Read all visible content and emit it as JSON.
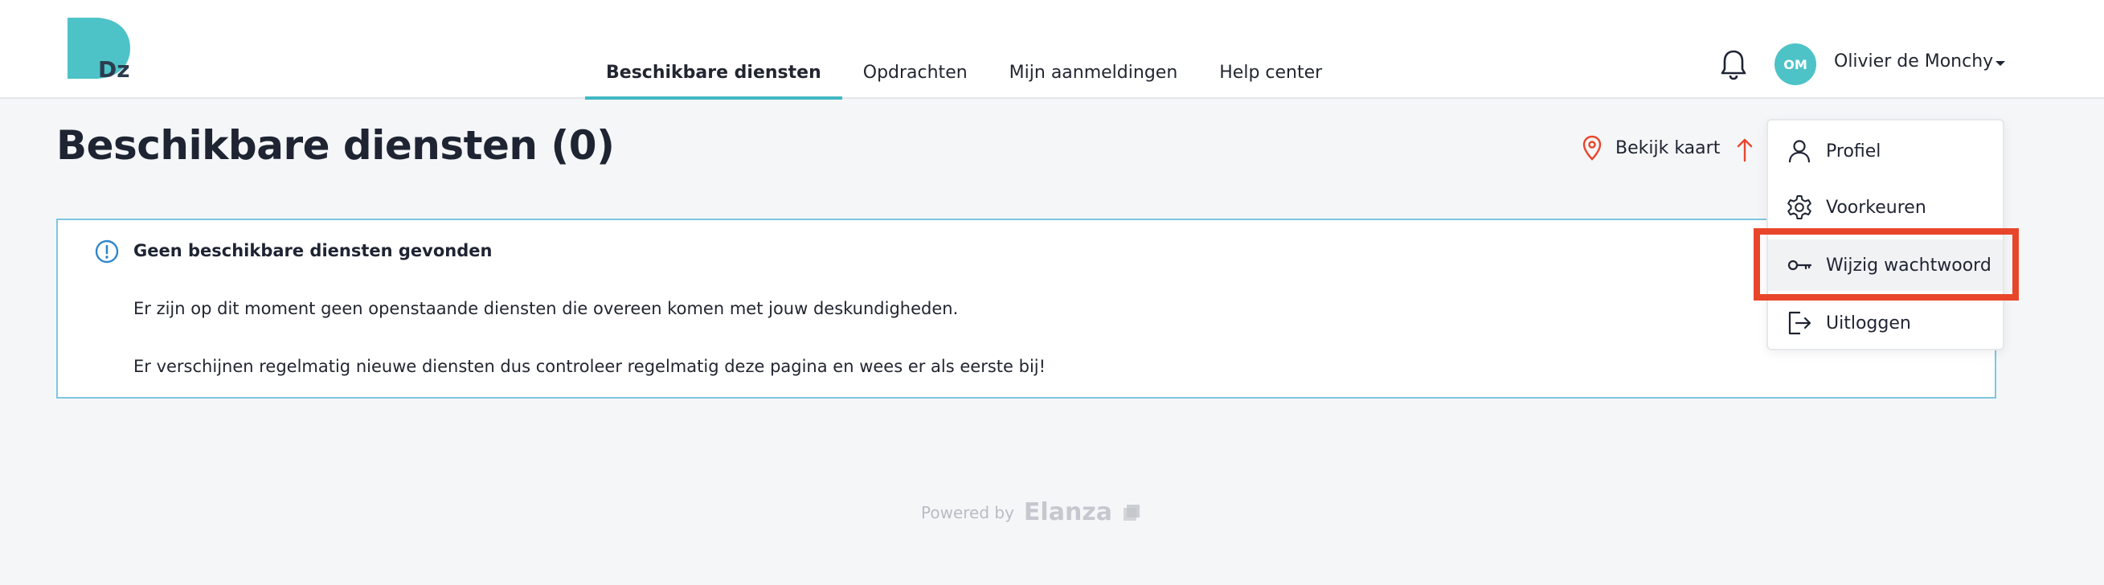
{
  "header": {
    "logo_letters": "Dz",
    "nav": [
      {
        "label": "Beschikbare diensten",
        "active": true
      },
      {
        "label": "Opdrachten",
        "active": false
      },
      {
        "label": "Mijn aanmeldingen",
        "active": false
      },
      {
        "label": "Help center",
        "active": false
      }
    ],
    "user": {
      "initials": "OM",
      "name": "Olivier de Monchy"
    }
  },
  "page": {
    "title": "Beschikbare diensten (0)",
    "map_link": "Bekijk kaart"
  },
  "info": {
    "title": "Geen beschikbare diensten gevonden",
    "line1": "Er zijn op dit moment geen openstaande diensten die overeen komen met jouw deskundigheden.",
    "line2": "Er verschijnen regelmatig nieuwe diensten dus controleer regelmatig deze pagina en wees er als eerste bij!"
  },
  "footer": {
    "powered_by": "Powered by",
    "brand": "Elanza"
  },
  "user_menu": {
    "items": [
      {
        "label": "Profiel",
        "icon": "user-icon"
      },
      {
        "label": "Voorkeuren",
        "icon": "gear-icon"
      },
      {
        "label": "Wijzig wachtwoord",
        "icon": "key-icon"
      },
      {
        "label": "Uitloggen",
        "icon": "logout-icon"
      }
    ]
  },
  "colors": {
    "accent": "#3fb8c2",
    "avatar": "#4ec3c7",
    "info_border": "#7fc6e0",
    "highlight": "#e8462b",
    "map_pin": "#e8462b"
  }
}
